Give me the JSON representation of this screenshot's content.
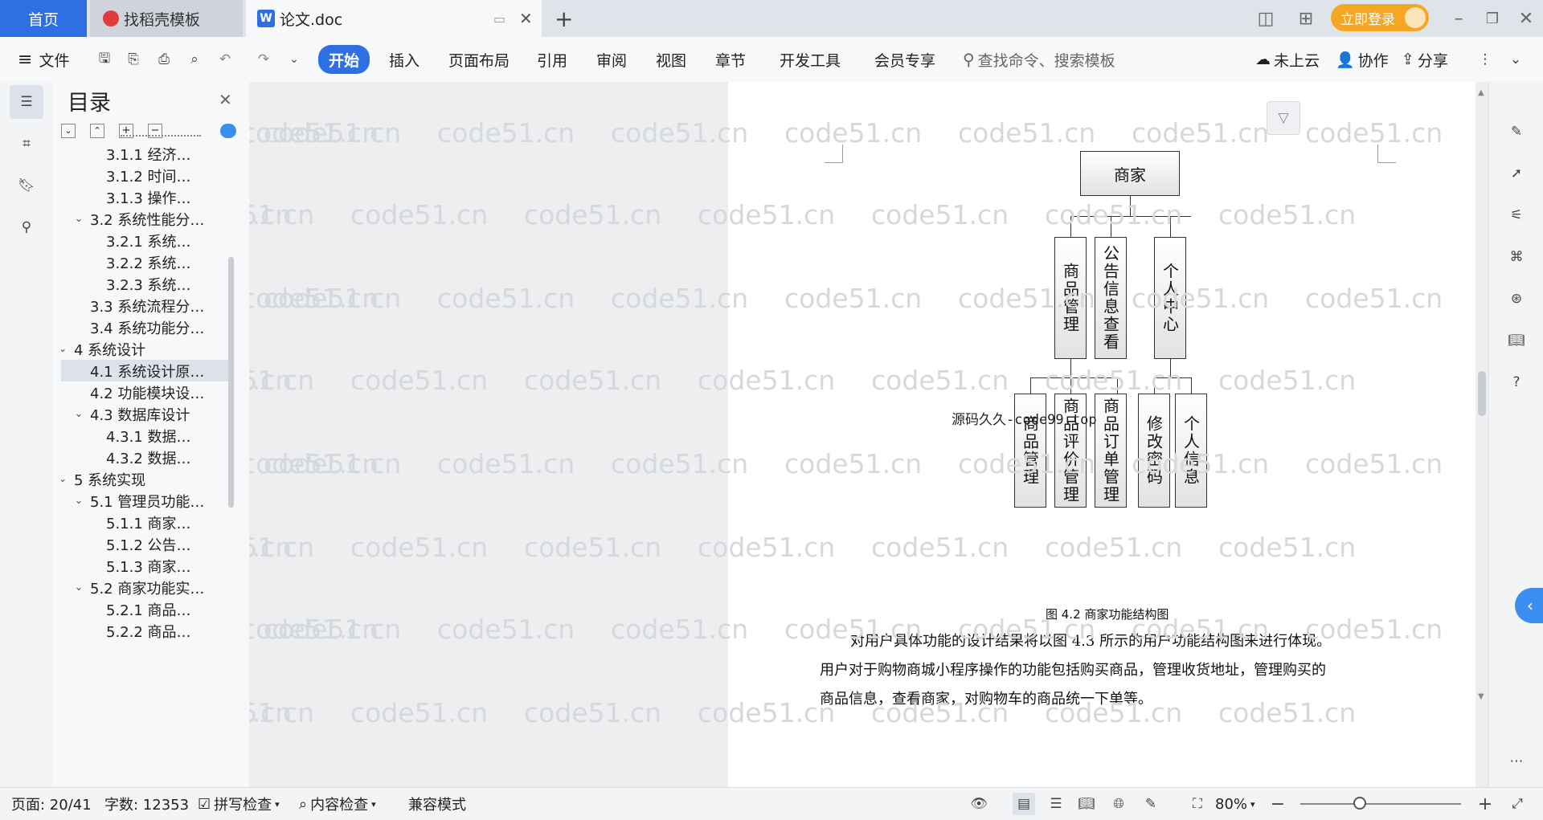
{
  "tabs": {
    "home": "首页",
    "daoke": "找稻壳模板",
    "doc": "论文.doc",
    "new_tab": "+"
  },
  "titlebar": {
    "login_label": "立即登录"
  },
  "toolbar": {
    "file_label": "文件",
    "menu": [
      "开始",
      "插入",
      "页面布局",
      "引用",
      "审阅",
      "视图",
      "章节",
      "开发工具",
      "会员专享"
    ],
    "search_placeholder": "查找命令、搜索模板",
    "cloud_label": "未上云",
    "collab_label": "协作",
    "share_label": "分享"
  },
  "outline": {
    "title": "目录",
    "items": [
      {
        "text": "3.1.1  经济…",
        "level": 3
      },
      {
        "text": "3.1.2  时间…",
        "level": 3
      },
      {
        "text": "3.1.3  操作…",
        "level": 3
      },
      {
        "text": "3.2  系统性能分…",
        "level": 2,
        "caret": "v"
      },
      {
        "text": "3.2.1  系统…",
        "level": 3
      },
      {
        "text": "3.2.2  系统…",
        "level": 3
      },
      {
        "text": "3.2.3  系统…",
        "level": 3
      },
      {
        "text": "3.3  系统流程分…",
        "level": 2
      },
      {
        "text": "3.4  系统功能分…",
        "level": 2
      },
      {
        "text": "4  系统设计",
        "level": 1,
        "caret": "v"
      },
      {
        "text": "4.1  系统设计原…",
        "level": 2,
        "selected": true
      },
      {
        "text": "4.2  功能模块设…",
        "level": 2
      },
      {
        "text": "4.3  数据库设计",
        "level": 2,
        "caret": "v"
      },
      {
        "text": "4.3.1  数据…",
        "level": 3
      },
      {
        "text": "4.3.2  数据…",
        "level": 3
      },
      {
        "text": "5  系统实现",
        "level": 1,
        "caret": "v"
      },
      {
        "text": "5.1  管理员功能…",
        "level": 2,
        "caret": "v"
      },
      {
        "text": "5.1.1  商家…",
        "level": 3
      },
      {
        "text": "5.1.2  公告…",
        "level": 3
      },
      {
        "text": "5.1.3  商家…",
        "level": 3
      },
      {
        "text": "5.2  商家功能实…",
        "level": 2,
        "caret": "v"
      },
      {
        "text": "5.2.1  商品…",
        "level": 3
      },
      {
        "text": "5.2.2  商品…",
        "level": 3
      }
    ]
  },
  "document": {
    "watermark": "code51.cn",
    "overlay_text": "源码久久-code99.top",
    "diagram": {
      "root": "商家",
      "level1": [
        "商品管理",
        "公告信息查看",
        "个人中心"
      ],
      "level2": [
        "商品管理",
        "商品评价管理",
        "商品订单管理",
        "修改密码",
        "个人信息"
      ]
    },
    "caption": "图 4.2  商家功能结构图",
    "paragraph_lines": [
      "对用户具体功能的设计结果将以图 4.3 所示的用户功能结构图来进行体现。",
      "用户对于购物商城小程序操作的功能包括购买商品，管理收货地址，管理购买的",
      "商品信息，查看商家，对购物车的商品统一下单等。"
    ]
  },
  "statusbar": {
    "page": "页面: 20/41",
    "words": "字数: 12353",
    "spell": "拼写检查",
    "content_check": "内容检查",
    "compat": "兼容模式",
    "zoom": "80%"
  },
  "colors": {
    "accent": "#2f6fe4",
    "login": "#f5a623"
  }
}
